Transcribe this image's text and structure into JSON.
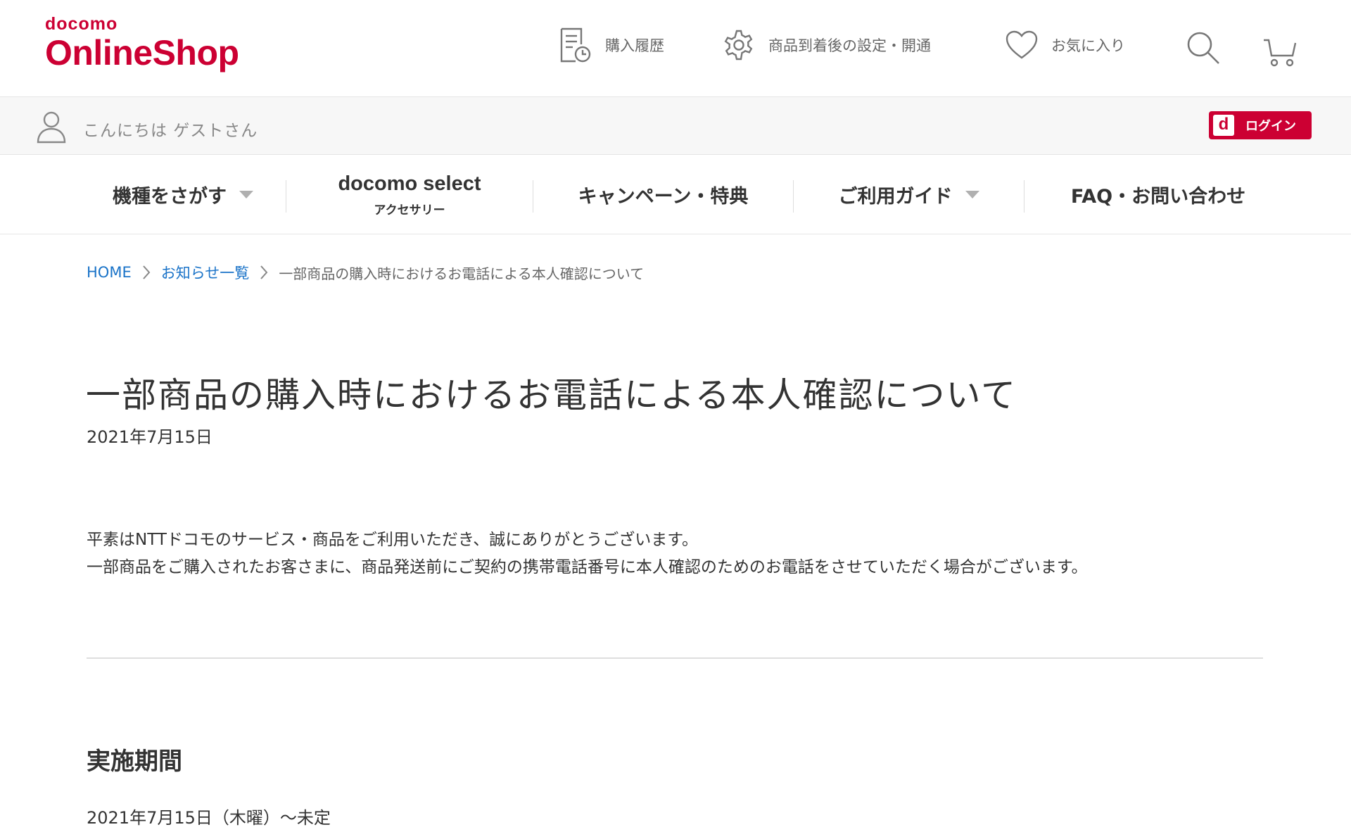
{
  "header": {
    "logo_small": "docomo",
    "logo_big": "OnlineShop",
    "nav": {
      "history": "購入履歴",
      "settings": "商品到着後の設定・開通",
      "favorites": "お気に入り"
    }
  },
  "greeting": {
    "text": "こんにちは ゲストさん",
    "login_mark": "d",
    "login_label": "ログイン"
  },
  "category_nav": {
    "find_device": "機種をさがす",
    "select_main": "docomo select",
    "select_sub": "アクセサリー",
    "campaign": "キャンペーン・特典",
    "guide": "ご利用ガイド",
    "faq": "FAQ・お問い合わせ"
  },
  "breadcrumb": {
    "home": "HOME",
    "news_list": "お知らせ一覧",
    "current": "一部商品の購入時におけるお電話による本人確認について"
  },
  "article": {
    "title": "一部商品の購入時におけるお電話による本人確認について",
    "date": "2021年7月15日",
    "paragraph_1": "平素はNTTドコモのサービス・商品をご利用いただき、誠にありがとうございます。",
    "paragraph_2": "一部商品をご購入されたお客さまに、商品発送前にご契約の携帯電話番号に本人確認のためのお電話をさせていただく場合がございます。",
    "section_heading": "実施期間",
    "section_text": "2021年7月15日（木曜）～未定"
  },
  "colors": {
    "brand": "#cc0033",
    "link": "#1a73c8",
    "text": "#333333",
    "muted": "#666666"
  },
  "icons": [
    "receipt-clock-icon",
    "gear-icon",
    "heart-icon",
    "search-icon",
    "cart-icon",
    "user-icon",
    "chevron-right-icon",
    "caret-down-icon"
  ]
}
